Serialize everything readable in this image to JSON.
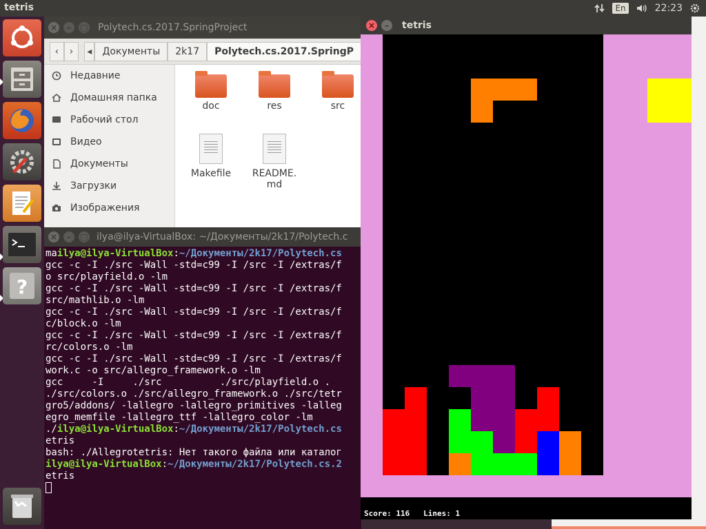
{
  "top_panel": {
    "app_title": "tetris",
    "lang": "En",
    "time": "22:23"
  },
  "launcher": {
    "items": [
      "ubuntu-dash",
      "files",
      "firefox",
      "system-settings",
      "text-editor",
      "terminal",
      "help",
      "trash"
    ]
  },
  "file_manager": {
    "title": "Polytech.cs.2017.SpringProject",
    "breadcrumbs": [
      "Документы",
      "2k17",
      "Polytech.cs.2017.SpringP"
    ],
    "sidebar": [
      {
        "label": "Недавние",
        "icon": "clock-icon"
      },
      {
        "label": "Домашняя папка",
        "icon": "home-icon"
      },
      {
        "label": "Рабочий стол",
        "icon": "desktop-icon"
      },
      {
        "label": "Видео",
        "icon": "video-icon"
      },
      {
        "label": "Документы",
        "icon": "document-icon"
      },
      {
        "label": "Загрузки",
        "icon": "download-icon"
      },
      {
        "label": "Изображения",
        "icon": "camera-icon"
      }
    ],
    "files": [
      {
        "name": "doc",
        "type": "folder"
      },
      {
        "name": "res",
        "type": "folder"
      },
      {
        "name": "src",
        "type": "folder"
      },
      {
        "name": "Makefile",
        "type": "file"
      },
      {
        "name": "README.",
        "name2": "md",
        "type": "file"
      }
    ]
  },
  "terminal": {
    "title": "ilya@ilya-VirtualBox: ~/Документы/2k17/Polytech.c",
    "lines": {
      "l1_pre": "ma",
      "l1_user": "ilya@ilya-VirtualBox",
      "l1_sep": ":",
      "l1_path": "~/Документы/2k17/Polytech.cs",
      "l2": "gcc -c -I ./src -Wall -std=c99 -I /src -I /extras/f",
      "l3": "o src/playfield.o -lm",
      "l4": "gcc -c -I ./src -Wall -std=c99 -I /src -I /extras/f",
      "l5": "src/mathlib.o -lm",
      "l6": "gcc -c -I ./src -Wall -std=c99 -I /src -I /extras/f",
      "l7": "c/block.o -lm",
      "l8": "gcc -c -I ./src -Wall -std=c99 -I /src -I /extras/f",
      "l9": "rc/colors.o -lm",
      "l10": "gcc -c -I ./src -Wall -std=c99 -I /src -I /extras/f",
      "l11": "work.c -o src/allegro_framework.o -lm",
      "l12": "gcc     -I     ./src          ./src/playfield.o .",
      "l13": "./src/colors.o ./src/allegro_framework.o ./src/tetr",
      "l14": "gro5/addons/ -lallegro -lallegro_primitives -lalleg",
      "l15": "egro_memfile -lallegro_ttf -lallegro_color -lm",
      "l16_pre": "./",
      "l16_user": "ilya@ilya-VirtualBox",
      "l16_sep": ":",
      "l16_path": "~/Документы/2k17/Polytech.cs",
      "l17": "etris",
      "l18": "bash: ./Allegrotetris: Нет такого файла или каталог",
      "l19_user": "ilya@ilya-VirtualBox",
      "l19_sep": ":",
      "l19_path": "~/Документы/2k17/Polytech.cs.2",
      "l20": "etris"
    }
  },
  "tetris": {
    "title": "tetris",
    "score_label": "Score:",
    "score": "116",
    "lines_label": "Lines:",
    "lines": "1",
    "colors": {
      "background": "#e59ae0",
      "board": "#000000",
      "orange": "#ff8000",
      "red": "#ff0000",
      "purple": "#800080",
      "green": "#00ff00",
      "blue": "#0000ff",
      "yellow": "#ffff00"
    },
    "board_cols": 10,
    "board_rows": 20,
    "falling_piece": {
      "color": "orange",
      "cells": [
        [
          4,
          2
        ],
        [
          5,
          2
        ],
        [
          6,
          2
        ],
        [
          4,
          3
        ]
      ]
    },
    "next_piece_color": "yellow",
    "stack": [
      {
        "c": 1,
        "r": 16,
        "color": "red"
      },
      {
        "c": 0,
        "r": 17,
        "color": "red"
      },
      {
        "c": 1,
        "r": 17,
        "color": "red"
      },
      {
        "c": 0,
        "r": 18,
        "color": "red"
      },
      {
        "c": 1,
        "r": 18,
        "color": "red"
      },
      {
        "c": 0,
        "r": 19,
        "color": "red"
      },
      {
        "c": 1,
        "r": 19,
        "color": "red"
      },
      {
        "c": 3,
        "r": 15,
        "color": "purple"
      },
      {
        "c": 4,
        "r": 15,
        "color": "purple"
      },
      {
        "c": 5,
        "r": 15,
        "color": "purple"
      },
      {
        "c": 4,
        "r": 16,
        "color": "purple"
      },
      {
        "c": 5,
        "r": 16,
        "color": "purple"
      },
      {
        "c": 4,
        "r": 17,
        "color": "purple"
      },
      {
        "c": 5,
        "r": 17,
        "color": "purple"
      },
      {
        "c": 5,
        "r": 18,
        "color": "purple"
      },
      {
        "c": 3,
        "r": 17,
        "color": "green"
      },
      {
        "c": 3,
        "r": 18,
        "color": "green"
      },
      {
        "c": 4,
        "r": 18,
        "color": "green"
      },
      {
        "c": 4,
        "r": 19,
        "color": "green"
      },
      {
        "c": 5,
        "r": 19,
        "color": "green"
      },
      {
        "c": 6,
        "r": 19,
        "color": "green"
      },
      {
        "c": 3,
        "r": 19,
        "color": "orange"
      },
      {
        "c": 7,
        "r": 16,
        "color": "red"
      },
      {
        "c": 6,
        "r": 17,
        "color": "red"
      },
      {
        "c": 7,
        "r": 17,
        "color": "red"
      },
      {
        "c": 6,
        "r": 18,
        "color": "red"
      },
      {
        "c": 7,
        "r": 18,
        "color": "blue"
      },
      {
        "c": 7,
        "r": 19,
        "color": "blue"
      },
      {
        "c": 8,
        "r": 18,
        "color": "orange"
      },
      {
        "c": 8,
        "r": 19,
        "color": "orange"
      }
    ]
  }
}
